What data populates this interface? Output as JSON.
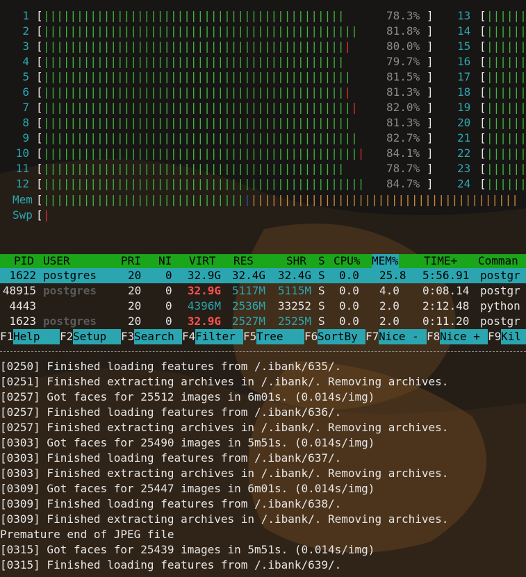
{
  "cpu_meters": [
    {
      "label": "1",
      "percent": "78.3%",
      "level": 0.783,
      "red": 0.0
    },
    {
      "label": "2",
      "percent": "81.8%",
      "level": 0.818,
      "red": 0.0
    },
    {
      "label": "3",
      "percent": "80.0%",
      "level": 0.8,
      "red": 0.005
    },
    {
      "label": "4",
      "percent": "79.7%",
      "level": 0.797,
      "red": 0.0
    },
    {
      "label": "5",
      "percent": "81.5%",
      "level": 0.815,
      "red": 0.0
    },
    {
      "label": "6",
      "percent": "81.3%",
      "level": 0.813,
      "red": 0.005
    },
    {
      "label": "7",
      "percent": "82.0%",
      "level": 0.82,
      "red": 0.005
    },
    {
      "label": "8",
      "percent": "81.3%",
      "level": 0.813,
      "red": 0.0
    },
    {
      "label": "9",
      "percent": "82.7%",
      "level": 0.827,
      "red": 0.0
    },
    {
      "label": "10",
      "percent": "84.1%",
      "level": 0.841,
      "red": 0.005
    },
    {
      "label": "11",
      "percent": "78.7%",
      "level": 0.787,
      "red": 0.0
    },
    {
      "label": "12",
      "percent": "84.7%",
      "level": 0.847,
      "red": 0.0
    }
  ],
  "cpu_meters_right": [
    "13",
    "14",
    "15",
    "16",
    "17",
    "18",
    "19",
    "20",
    "21",
    "22",
    "23",
    "24"
  ],
  "memory": {
    "label": "Mem",
    "used": 0.44,
    "cache": 0.56
  },
  "swap": {
    "label": "Swp",
    "used": 0.005
  },
  "header_columns": [
    "PID",
    "USER",
    "PRI",
    "NI",
    "VIRT",
    "RES",
    "SHR",
    "S",
    "CPU%",
    "MEM%",
    "TIME+",
    "Comman"
  ],
  "processes": [
    {
      "pid": "1622",
      "user": "postgres",
      "pri": "20",
      "ni": "0",
      "virt": "32.9G",
      "res": "32.4G",
      "shr": "32.4G",
      "s": "S",
      "cpu": "0.0",
      "mem": "25.8",
      "time": "5:56.91",
      "cmd": "postgr",
      "selected": true
    },
    {
      "pid": "48915",
      "user": "postgres",
      "pri": "20",
      "ni": "0",
      "virt": "32.9G",
      "res": "5117M",
      "shr": "5115M",
      "s": "S",
      "cpu": "0.0",
      "mem": "4.0",
      "time": "0:08.14",
      "cmd": "postgr",
      "selected": false
    },
    {
      "pid": "4443",
      "user": "",
      "pri": "20",
      "ni": "0",
      "virt": "4396M",
      "res": "2536M",
      "shr": "33252",
      "s": "S",
      "cpu": "0.0",
      "mem": "2.0",
      "time": "2:12.48",
      "cmd": "python",
      "selected": false
    },
    {
      "pid": "1623",
      "user": "postgres",
      "pri": "20",
      "ni": "0",
      "virt": "32.9G",
      "res": "2527M",
      "shr": "2525M",
      "s": "S",
      "cpu": "0.0",
      "mem": "2.0",
      "time": "0:11.20",
      "cmd": "postgr",
      "selected": false
    }
  ],
  "function_keys": [
    {
      "key": "F1",
      "label": "Help"
    },
    {
      "key": "F2",
      "label": "Setup"
    },
    {
      "key": "F3",
      "label": "Search"
    },
    {
      "key": "F4",
      "label": "Filter"
    },
    {
      "key": "F5",
      "label": "Tree"
    },
    {
      "key": "F6",
      "label": "SortBy"
    },
    {
      "key": "F7",
      "label": "Nice -"
    },
    {
      "key": "F8",
      "label": "Nice +"
    },
    {
      "key": "F9",
      "label": "Kil"
    }
  ],
  "log_lines": [
    "[0250] Finished loading features from /.ibank/635/.",
    "[0251] Finished extracting archives in /.ibank/. Removing archives.",
    "[0257] Got faces for 25512 images in 6m01s. (0.014s/img)",
    "[0257] Finished loading features from /.ibank/636/.",
    "[0257] Finished extracting archives in /.ibank/. Removing archives.",
    "[0303] Got faces for 25490 images in 5m51s. (0.014s/img)",
    "[0303] Finished loading features from /.ibank/637/.",
    "[0303] Finished extracting archives in /.ibank/. Removing archives.",
    "[0309] Got faces for 25447 images in 6m01s. (0.014s/img)",
    "[0309] Finished loading features from /.ibank/638/.",
    "[0309] Finished extracting archives in /.ibank/. Removing archives.",
    "Premature end of JPEG file",
    "[0315] Got faces for 25439 images in 5m51s. (0.014s/img)",
    "[0315] Finished loading features from /.ibank/639/."
  ],
  "colors": {
    "bar_green": "#3fb43f",
    "bar_red": "#d83030",
    "mem_orange": "#c98a3a",
    "accent_cyan": "#2ba6b0",
    "header_green": "#1aa51a"
  }
}
